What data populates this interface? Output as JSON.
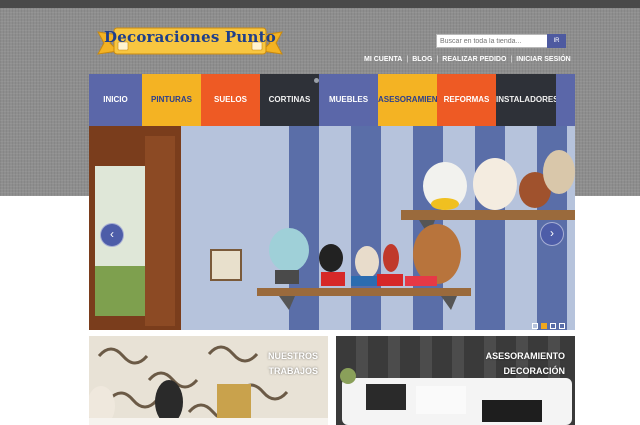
{
  "brand": {
    "name": "Decoraciones Punto"
  },
  "search": {
    "placeholder": "Buscar en toda la tienda...",
    "button_label": "IR"
  },
  "top_links": [
    "MI CUENTA",
    "BLOG",
    "REALIZAR PEDIDO",
    "INICIAR SESIÓN"
  ],
  "top_links_separator": "|",
  "nav": {
    "items": [
      {
        "label": "INICIO",
        "color": "#5b67a9"
      },
      {
        "label": "PINTURAS",
        "color": "#f4b323"
      },
      {
        "label": "SUELOS",
        "color": "#ee5a24"
      },
      {
        "label": "CORTINAS",
        "color": "#2e3138"
      },
      {
        "label": "MUEBLES",
        "color": "#5b67a9"
      },
      {
        "label": "ASESORAMIENTO",
        "color": "#f4b323"
      },
      {
        "label": "REFORMAS",
        "color": "#ee5a24"
      },
      {
        "label": "INSTALADORES",
        "color": "#2e3138"
      }
    ]
  },
  "slider": {
    "prev_icon": "chevron-left-icon",
    "next_icon": "chevron-right-icon",
    "prev_glyph": "‹",
    "next_glyph": "›",
    "slide_count": 4,
    "active_slide": 2
  },
  "tiles": [
    {
      "line1": "NUESTROS",
      "line2": "TRABAJOS"
    },
    {
      "line1": "ASESORAMIENTO",
      "line2": "DECORACIÓN"
    }
  ],
  "colors": {
    "accent_blue": "#5b67a9",
    "accent_yellow": "#f4b323",
    "accent_orange": "#ee5a24",
    "dark": "#2e3138"
  }
}
